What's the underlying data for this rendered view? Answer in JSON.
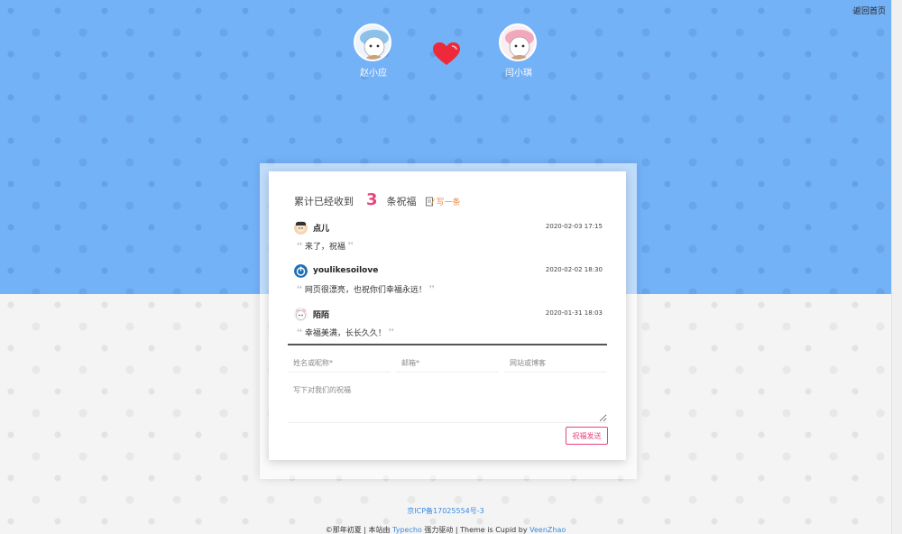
{
  "header": {
    "back_label": "返回首页"
  },
  "couple": {
    "left": {
      "name": "赵小应"
    },
    "right": {
      "name": "闫小琪"
    }
  },
  "summary": {
    "prefix": "累计已经收到",
    "count": "3",
    "suffix": "条祝福",
    "write_label": "写一条"
  },
  "comments": [
    {
      "author": "点儿",
      "time": "2020-02-03 17:15",
      "text": "来了，祝福"
    },
    {
      "author": "youlikesoilove",
      "time": "2020-02-02 18:30",
      "text": "网页很漂亮，也祝你们幸福永远！"
    },
    {
      "author": "陌陌",
      "time": "2020-01-31 18:03",
      "text": "幸福美满，长长久久！"
    }
  ],
  "form": {
    "name_placeholder": "姓名或昵称*",
    "email_placeholder": "邮箱*",
    "site_placeholder": "网站或博客",
    "message_placeholder": "写下对我们的祝福",
    "submit_label": "祝福发送"
  },
  "footer": {
    "icp": "京ICP备17025554号-3",
    "credit_pre": "©那年初夏 | 本站由 ",
    "typecho": "Typecho",
    "credit_mid": " 强力驱动 | Theme is Cupid by ",
    "author": "VeenZhao"
  },
  "colors": {
    "accent": "#e8457a",
    "sky": "#74b2f7",
    "link": "#3a8be0",
    "heart": "#ee2a3a"
  }
}
